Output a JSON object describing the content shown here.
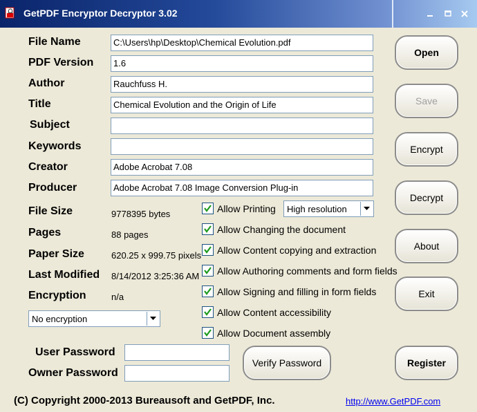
{
  "window": {
    "title": "GetPDF Encryptor Decryptor 3.02"
  },
  "labels": {
    "file_name": "File Name",
    "pdf_version": "PDF Version",
    "author": "Author",
    "title": "Title",
    "subject": "Subject",
    "keywords": "Keywords",
    "creator": "Creator",
    "producer": "Producer",
    "file_size": "File Size",
    "pages": "Pages",
    "paper_size": "Paper Size",
    "last_modified": "Last Modified",
    "encryption": "Encryption",
    "user_password": "User Password",
    "owner_password": "Owner Password"
  },
  "fields": {
    "file_name": "C:\\Users\\hp\\Desktop\\Chemical Evolution.pdf",
    "pdf_version": "1.6",
    "author": "Rauchfuss H.",
    "title": "Chemical Evolution and the Origin of Life",
    "subject": "",
    "keywords": "",
    "creator": "Adobe Acrobat 7.08",
    "producer": "Adobe Acrobat 7.08 Image Conversion Plug-in"
  },
  "info": {
    "file_size": "9778395 bytes",
    "pages": "88 pages",
    "paper_size": "620.25 x 999.75 pixels",
    "last_modified": "8/14/2012 3:25:36 AM",
    "encryption": "n/a"
  },
  "permissions": [
    {
      "label": "Allow Printing",
      "checked": true
    },
    {
      "label": "Allow Changing the document",
      "checked": true
    },
    {
      "label": "Allow Content copying and extraction",
      "checked": true
    },
    {
      "label": "Allow Authoring comments and form fields",
      "checked": true
    },
    {
      "label": "Allow Signing and filling in form fields",
      "checked": true
    },
    {
      "label": "Allow Content accessibility",
      "checked": true
    },
    {
      "label": "Allow Document assembly",
      "checked": true
    }
  ],
  "printing_resolution": {
    "selected": "High resolution"
  },
  "encryption_select": {
    "selected": "No encryption"
  },
  "buttons": {
    "open": "Open",
    "save": "Save",
    "encrypt": "Encrypt",
    "decrypt": "Decrypt",
    "about": "About",
    "exit": "Exit",
    "register": "Register",
    "verify_password": "Verify Password"
  },
  "footer": {
    "copyright": "(C) Copyright 2000-2013 Bureausoft and GetPDF, Inc.",
    "website": "http://www.GetPDF.com"
  },
  "colors": {
    "titlebar": "#0a246a",
    "window_bg": "#ece9d8",
    "link": "#0000ee",
    "checkbox_border": "#1c5180"
  },
  "icons": [
    "app-icon",
    "minimize-icon",
    "maximize-icon",
    "close-icon",
    "checkmark-icon",
    "chevron-down-icon"
  ]
}
